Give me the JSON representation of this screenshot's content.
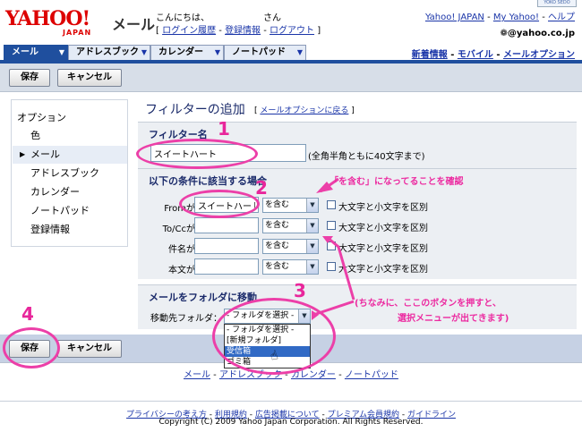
{
  "header": {
    "logo_text": "YAHOO!",
    "logo_sub": "JAPAN",
    "mail_title": "メール",
    "greeting_prefix": "こんにちは、",
    "greeting_suffix": "さん",
    "login_history": "ログイン履歴",
    "registration_info": "登録情報",
    "logout": "ログアウト",
    "yahoo_japan": "Yahoo! JAPAN",
    "my_yahoo": "My Yahoo!",
    "help": "ヘルプ",
    "email": "@yahoo.co.jp",
    "badge": "YOKO SEDO"
  },
  "tabs": [
    {
      "label": "メール",
      "active": true
    },
    {
      "label": "アドレスブック",
      "active": false
    },
    {
      "label": "カレンダー",
      "active": false
    },
    {
      "label": "ノートパッド",
      "active": false
    }
  ],
  "sublinks": {
    "news": "新着情報",
    "mobile": "モバイル",
    "mail_options": "メールオプション"
  },
  "toolbar": {
    "save_label": "保存",
    "cancel_label": "キャンセル"
  },
  "sidebar": {
    "heading": "オプション",
    "items": [
      {
        "label": "色",
        "active": false
      },
      {
        "label": "メール",
        "active": true
      },
      {
        "label": "アドレスブック",
        "active": false
      },
      {
        "label": "カレンダー",
        "active": false
      },
      {
        "label": "ノートパッド",
        "active": false
      },
      {
        "label": "登録情報",
        "active": false
      }
    ]
  },
  "main": {
    "title": "フィルターの追加",
    "back_link": "メールオプションに戻る",
    "filter_name_heading": "フィルター名",
    "filter_name_value": "スイートハート",
    "filter_name_hint": "(全角半角ともに40文字まで)",
    "conditions_heading": "以下の条件に該当する場合",
    "conditions": [
      {
        "label": "Fromが",
        "value": "スイートハート",
        "operator": "を含む",
        "case_label": "大文字と小文字を区別"
      },
      {
        "label": "To/Ccが",
        "value": "",
        "operator": "を含む",
        "case_label": "大文字と小文字を区別"
      },
      {
        "label": "件名が",
        "value": "",
        "operator": "を含む",
        "case_label": "大文字と小文字を区別"
      },
      {
        "label": "本文が",
        "value": "",
        "operator": "を含む",
        "case_label": "大文字と小文字を区別"
      }
    ],
    "move_heading": "メールをフォルダに移動",
    "move_label": "移動先フォルダ：",
    "folder_select_value": "- フォルダを選択 -",
    "folder_options": [
      "- フォルダを選択 -",
      "[新規フォルダ]",
      "受信箱",
      "ゴミ箱"
    ],
    "folder_selected_index": 2
  },
  "annotations": {
    "num1": "1",
    "num2": "2",
    "num3": "3",
    "num4": "4",
    "note_contains": "「を含む」になってることを確認",
    "note_button_line1": "(ちなみに、ここのボタンを押すと、",
    "note_button_line2": "選択メニューが出てきます)",
    "accent_color": "#e8269b"
  },
  "footer": {
    "nav": [
      "メール",
      "アドレスブック",
      "カレンダー",
      "ノートパッド"
    ],
    "links": [
      "プライバシーの考え方",
      "利用規約",
      "広告掲載について",
      "プレミアム会員規約",
      "ガイドライン"
    ],
    "copyright": "Copyright (C) 2009 Yahoo Japan Corporation. All Rights Reserved."
  }
}
